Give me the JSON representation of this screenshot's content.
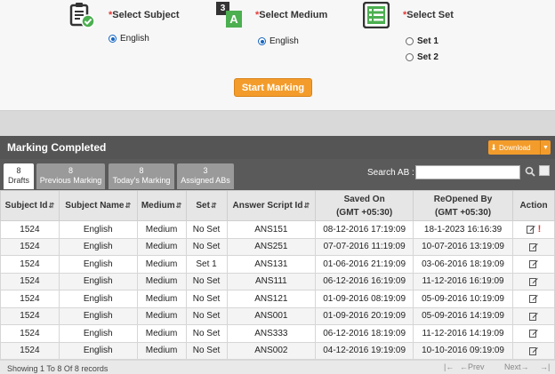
{
  "selection": {
    "subject": {
      "required_mark": "*",
      "label": "Select Subject",
      "option": "English",
      "icon": "clipboard-check-icon"
    },
    "medium": {
      "required_mark": "*",
      "label": "Select Medium",
      "option": "English",
      "icon": "translate-icon",
      "icon_glyph_1": "3",
      "icon_glyph_2": "A"
    },
    "set": {
      "required_mark": "*",
      "label": "Select Set",
      "options": [
        "Set 1",
        "Set 2"
      ],
      "icon": "list-icon"
    },
    "start_button": "Start Marking"
  },
  "panel": {
    "title": "Marking Completed",
    "download_label": "Download"
  },
  "tabs": [
    {
      "count": "8",
      "label": "Drafts",
      "active": true
    },
    {
      "count": "8",
      "label": "Previous Marking",
      "active": false
    },
    {
      "count": "8",
      "label": "Today's Marking",
      "active": false
    },
    {
      "count": "3",
      "label": "Assigned ABs",
      "active": false
    }
  ],
  "search": {
    "label": "Search AB :",
    "value": ""
  },
  "table": {
    "headers": [
      "Subject Id",
      "Subject Name",
      "Medium",
      "Set",
      "Answer Script Id",
      "Saved On",
      "(GMT +05:30)",
      "ReOpened By",
      "(GMT +05:30)",
      "Action"
    ],
    "rows": [
      [
        "1524",
        "English",
        "Medium",
        "No Set",
        "ANS151",
        "08-12-2016 17:19:09",
        "18-1-2023 16:16:39"
      ],
      [
        "1524",
        "English",
        "Medium",
        "No Set",
        "ANS251",
        "07-07-2016 11:19:09",
        "10-07-2016 13:19:09"
      ],
      [
        "1524",
        "English",
        "Medium",
        "Set 1",
        "ANS131",
        "01-06-2016 21:19:09",
        "03-06-2016 18:19:09"
      ],
      [
        "1524",
        "English",
        "Medium",
        "No Set",
        "ANS111",
        "06-12-2016 16:19:09",
        "11-12-2016 16:19:09"
      ],
      [
        "1524",
        "English",
        "Medium",
        "No Set",
        "ANS121",
        "01-09-2016 08:19:09",
        "05-09-2016 10:19:09"
      ],
      [
        "1524",
        "English",
        "Medium",
        "No Set",
        "ANS001",
        "01-09-2016 20:19:09",
        "05-09-2016 14:19:09"
      ],
      [
        "1524",
        "English",
        "Medium",
        "No Set",
        "ANS333",
        "06-12-2016 18:19:09",
        "11-12-2016 14:19:09"
      ],
      [
        "1524",
        "English",
        "Medium",
        "No Set",
        "ANS002",
        "04-12-2016 19:19:09",
        "10-10-2016 09:19:09"
      ]
    ],
    "warning_mark": "!"
  },
  "footer": {
    "showing": "Showing 1 To 8 Of 8 records",
    "first": "|←",
    "prev": "←Prev",
    "next": "Next→",
    "last": "→|"
  },
  "colors": {
    "accent": "#f39c2b",
    "header_bar": "#555555",
    "radio_on": "#1565c0"
  }
}
